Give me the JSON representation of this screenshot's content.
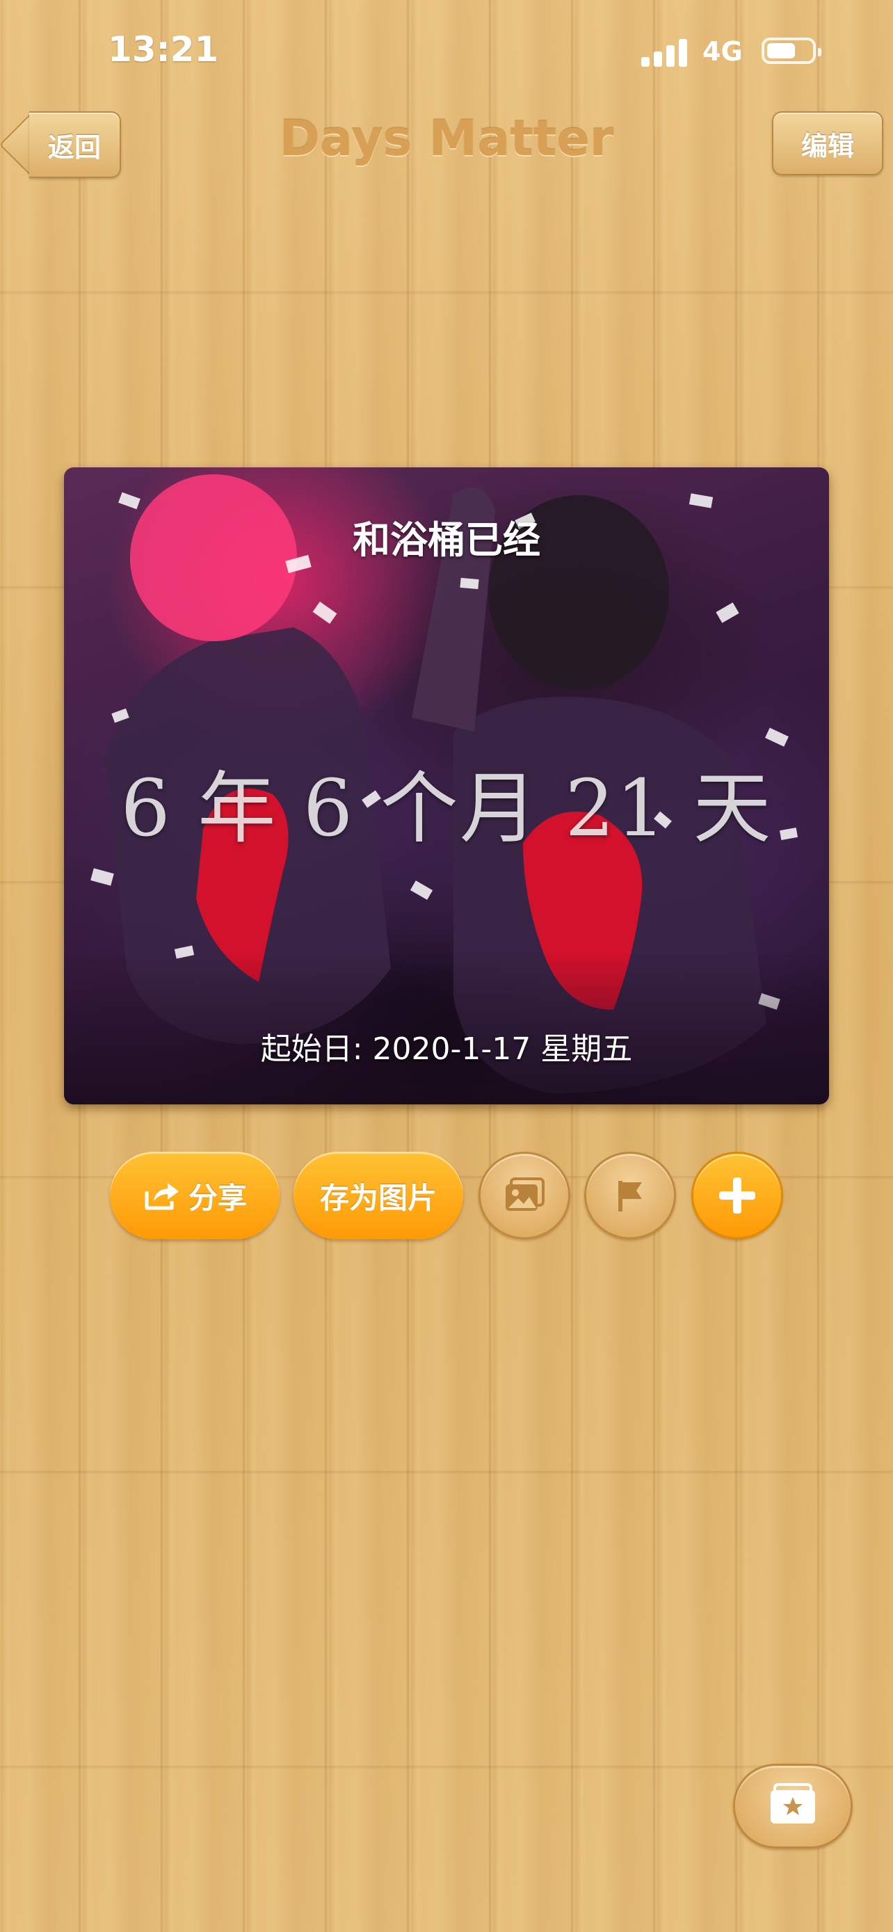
{
  "status_bar": {
    "time": "13:21",
    "network": "4G"
  },
  "nav": {
    "back_label": "返回",
    "title": "Days Matter",
    "edit_label": "编辑"
  },
  "card": {
    "title": "和浴桶已经",
    "duration": "6 年 6 个月 21 天",
    "start_date": "起始日: 2020-1-17 星期五"
  },
  "actions": {
    "share_label": "分享",
    "save_label": "存为图片",
    "icons": {
      "share": "share-icon",
      "photo": "photo-icon",
      "flag": "flag-icon",
      "add": "plus-icon",
      "gallery": "star-card-stack-icon"
    }
  },
  "colors": {
    "accent_orange": "#ff9a05",
    "wood": "#e2b872",
    "title_tan": "#d8a055"
  }
}
